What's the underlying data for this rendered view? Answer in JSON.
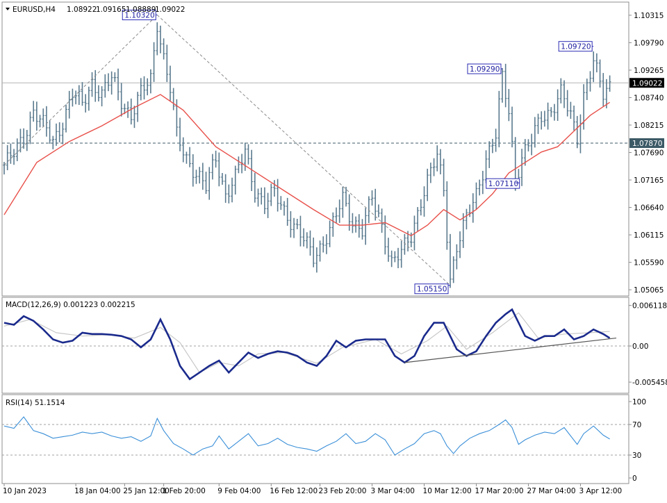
{
  "chart_data": [
    {
      "type": "ohlc",
      "name": "price-panel",
      "header": {
        "symbol": "EURUSD,H4",
        "open": "1.08922",
        "high": "1.09165",
        "low": "1.08889",
        "close": "1.09022"
      },
      "ylim": [
        1.05,
        1.105
      ],
      "yticks": [
        "1.10315",
        "1.09790",
        "1.09265",
        "1.08740",
        "1.08215",
        "1.07690",
        "1.07165",
        "1.06640",
        "1.06115",
        "1.05590",
        "1.05065"
      ],
      "current_price": "1.09022",
      "level_line": "1.07870",
      "ma_color": "#e8504a",
      "bar_color": "#5a7a8e",
      "anchors": [
        {
          "x": 0,
          "y": 1.0745
        },
        {
          "x": 3,
          "y": 1.0765
        },
        {
          "x": 6,
          "y": 1.08
        },
        {
          "x": 9,
          "y": 1.085
        },
        {
          "x": 12,
          "y": 1.082
        },
        {
          "x": 15,
          "y": 1.079
        },
        {
          "x": 18,
          "y": 1.083
        },
        {
          "x": 21,
          "y": 1.088
        },
        {
          "x": 24,
          "y": 1.086
        },
        {
          "x": 27,
          "y": 1.0905
        },
        {
          "x": 30,
          "y": 1.088
        },
        {
          "x": 33,
          "y": 1.091
        },
        {
          "x": 36,
          "y": 1.087
        },
        {
          "x": 39,
          "y": 1.084
        },
        {
          "x": 42,
          "y": 1.088
        },
        {
          "x": 45,
          "y": 1.091
        },
        {
          "x": 47,
          "y": 1.102
        },
        {
          "x": 49,
          "y": 1.095
        },
        {
          "x": 51,
          "y": 1.089
        },
        {
          "x": 53,
          "y": 1.08
        },
        {
          "x": 56,
          "y": 1.076
        },
        {
          "x": 59,
          "y": 1.073
        },
        {
          "x": 62,
          "y": 1.07
        },
        {
          "x": 65,
          "y": 1.076
        },
        {
          "x": 68,
          "y": 1.069
        },
        {
          "x": 71,
          "y": 1.072
        },
        {
          "x": 74,
          "y": 1.077
        },
        {
          "x": 77,
          "y": 1.07
        },
        {
          "x": 80,
          "y": 1.067
        },
        {
          "x": 83,
          "y": 1.069
        },
        {
          "x": 86,
          "y": 1.066
        },
        {
          "x": 89,
          "y": 1.063
        },
        {
          "x": 92,
          "y": 1.06
        },
        {
          "x": 95,
          "y": 1.057
        },
        {
          "x": 98,
          "y": 1.06
        },
        {
          "x": 101,
          "y": 1.063
        },
        {
          "x": 104,
          "y": 1.068
        },
        {
          "x": 107,
          "y": 1.064
        },
        {
          "x": 110,
          "y": 1.062
        },
        {
          "x": 113,
          "y": 1.068
        },
        {
          "x": 116,
          "y": 1.063
        },
        {
          "x": 119,
          "y": 1.056
        },
        {
          "x": 122,
          "y": 1.0575
        },
        {
          "x": 125,
          "y": 1.061
        },
        {
          "x": 128,
          "y": 1.068
        },
        {
          "x": 131,
          "y": 1.073
        },
        {
          "x": 133,
          "y": 1.076
        },
        {
          "x": 135,
          "y": 1.07
        },
        {
          "x": 137,
          "y": 1.053
        },
        {
          "x": 139,
          "y": 1.059
        },
        {
          "x": 142,
          "y": 1.064
        },
        {
          "x": 145,
          "y": 1.069
        },
        {
          "x": 148,
          "y": 1.076
        },
        {
          "x": 151,
          "y": 1.08
        },
        {
          "x": 153,
          "y": 1.091
        },
        {
          "x": 155,
          "y": 1.085
        },
        {
          "x": 157,
          "y": 1.072
        },
        {
          "x": 159,
          "y": 1.076
        },
        {
          "x": 162,
          "y": 1.079
        },
        {
          "x": 165,
          "y": 1.084
        },
        {
          "x": 168,
          "y": 1.085
        },
        {
          "x": 171,
          "y": 1.088
        },
        {
          "x": 174,
          "y": 1.084
        },
        {
          "x": 176,
          "y": 1.08
        },
        {
          "x": 178,
          "y": 1.088
        },
        {
          "x": 181,
          "y": 1.094
        },
        {
          "x": 184,
          "y": 1.088
        },
        {
          "x": 186,
          "y": 1.09
        }
      ],
      "ma": [
        {
          "x": 0,
          "y": 1.065
        },
        {
          "x": 10,
          "y": 1.075
        },
        {
          "x": 20,
          "y": 1.079
        },
        {
          "x": 30,
          "y": 1.082
        },
        {
          "x": 40,
          "y": 1.0855
        },
        {
          "x": 48,
          "y": 1.088
        },
        {
          "x": 55,
          "y": 1.085
        },
        {
          "x": 65,
          "y": 1.078
        },
        {
          "x": 75,
          "y": 1.074
        },
        {
          "x": 85,
          "y": 1.07
        },
        {
          "x": 95,
          "y": 1.066
        },
        {
          "x": 103,
          "y": 1.063
        },
        {
          "x": 110,
          "y": 1.063
        },
        {
          "x": 117,
          "y": 1.0635
        },
        {
          "x": 125,
          "y": 1.061
        },
        {
          "x": 130,
          "y": 1.063
        },
        {
          "x": 135,
          "y": 1.066
        },
        {
          "x": 140,
          "y": 1.064
        },
        {
          "x": 145,
          "y": 1.066
        },
        {
          "x": 150,
          "y": 1.069
        },
        {
          "x": 155,
          "y": 1.073
        },
        {
          "x": 160,
          "y": 1.075
        },
        {
          "x": 165,
          "y": 1.077
        },
        {
          "x": 170,
          "y": 1.078
        },
        {
          "x": 175,
          "y": 1.081
        },
        {
          "x": 180,
          "y": 1.084
        },
        {
          "x": 186,
          "y": 1.0865
        }
      ],
      "annotations": [
        {
          "label": "1.10320",
          "bar": 47,
          "price": 1.1032
        },
        {
          "label": "1.05150",
          "bar": 137,
          "price": 1.0515
        },
        {
          "label": "1.09290",
          "bar": 153,
          "price": 1.0929
        },
        {
          "label": "1.07110",
          "bar": 157,
          "price": 1.0711
        },
        {
          "label": "1.09720",
          "bar": 181,
          "price": 1.0972
        }
      ],
      "trendlines": [
        {
          "style": "dashed",
          "from": {
            "bar": 0,
            "price": 1.0745
          },
          "to": {
            "bar": 47,
            "price": 1.1032
          }
        },
        {
          "style": "dashed",
          "from": {
            "bar": 47,
            "price": 1.1032
          },
          "to": {
            "bar": 137,
            "price": 1.0515
          }
        }
      ]
    },
    {
      "type": "line",
      "name": "macd-panel",
      "title": "MACD(12,26,9) 0.001223 0.002215",
      "ylim": [
        -0.0065,
        0.0065
      ],
      "yticks": [
        "0.006118",
        "0.00",
        "-0.005458"
      ],
      "macd_color": "#1a2a8c",
      "signal_color": "#c8c8c8",
      "macd": [
        {
          "x": 0,
          "y": 0.0035
        },
        {
          "x": 3,
          "y": 0.0032
        },
        {
          "x": 6,
          "y": 0.0045
        },
        {
          "x": 9,
          "y": 0.0038
        },
        {
          "x": 12,
          "y": 0.0025
        },
        {
          "x": 15,
          "y": 0.001
        },
        {
          "x": 18,
          "y": 0.0005
        },
        {
          "x": 21,
          "y": 0.0008
        },
        {
          "x": 24,
          "y": 0.002
        },
        {
          "x": 27,
          "y": 0.0018
        },
        {
          "x": 30,
          "y": 0.0018
        },
        {
          "x": 33,
          "y": 0.0017
        },
        {
          "x": 36,
          "y": 0.0015
        },
        {
          "x": 39,
          "y": 0.001
        },
        {
          "x": 42,
          "y": -0.0002
        },
        {
          "x": 45,
          "y": 0.001
        },
        {
          "x": 48,
          "y": 0.004
        },
        {
          "x": 51,
          "y": 0.001
        },
        {
          "x": 54,
          "y": -0.003
        },
        {
          "x": 57,
          "y": -0.005
        },
        {
          "x": 60,
          "y": -0.004
        },
        {
          "x": 63,
          "y": -0.003
        },
        {
          "x": 66,
          "y": -0.0022
        },
        {
          "x": 69,
          "y": -0.004
        },
        {
          "x": 72,
          "y": -0.0025
        },
        {
          "x": 75,
          "y": -0.001
        },
        {
          "x": 78,
          "y": -0.0018
        },
        {
          "x": 81,
          "y": -0.0012
        },
        {
          "x": 84,
          "y": -0.0008
        },
        {
          "x": 87,
          "y": -0.001
        },
        {
          "x": 90,
          "y": -0.0015
        },
        {
          "x": 93,
          "y": -0.0025
        },
        {
          "x": 96,
          "y": -0.003
        },
        {
          "x": 99,
          "y": -0.0015
        },
        {
          "x": 102,
          "y": 0.0008
        },
        {
          "x": 105,
          "y": -0.0002
        },
        {
          "x": 108,
          "y": 0.0008
        },
        {
          "x": 111,
          "y": 0.001
        },
        {
          "x": 114,
          "y": 0.001
        },
        {
          "x": 117,
          "y": 0.001
        },
        {
          "x": 120,
          "y": -0.0015
        },
        {
          "x": 123,
          "y": -0.0025
        },
        {
          "x": 126,
          "y": -0.0015
        },
        {
          "x": 129,
          "y": 0.0015
        },
        {
          "x": 132,
          "y": 0.0035
        },
        {
          "x": 135,
          "y": 0.0035
        },
        {
          "x": 137,
          "y": 0.0015
        },
        {
          "x": 139,
          "y": -0.0005
        },
        {
          "x": 142,
          "y": -0.0015
        },
        {
          "x": 145,
          "y": -0.0008
        },
        {
          "x": 148,
          "y": 0.0015
        },
        {
          "x": 151,
          "y": 0.0035
        },
        {
          "x": 154,
          "y": 0.0048
        },
        {
          "x": 156,
          "y": 0.0055
        },
        {
          "x": 158,
          "y": 0.0035
        },
        {
          "x": 160,
          "y": 0.0015
        },
        {
          "x": 163,
          "y": 0.0008
        },
        {
          "x": 166,
          "y": 0.0015
        },
        {
          "x": 169,
          "y": 0.0015
        },
        {
          "x": 172,
          "y": 0.0025
        },
        {
          "x": 175,
          "y": 0.001
        },
        {
          "x": 178,
          "y": 0.0015
        },
        {
          "x": 181,
          "y": 0.0025
        },
        {
          "x": 184,
          "y": 0.0018
        },
        {
          "x": 186,
          "y": 0.0012
        }
      ],
      "signal": [
        {
          "x": 0,
          "y": 0.003
        },
        {
          "x": 8,
          "y": 0.004
        },
        {
          "x": 16,
          "y": 0.002
        },
        {
          "x": 24,
          "y": 0.0015
        },
        {
          "x": 32,
          "y": 0.0017
        },
        {
          "x": 40,
          "y": 0.0012
        },
        {
          "x": 48,
          "y": 0.0028
        },
        {
          "x": 54,
          "y": 0.0005
        },
        {
          "x": 60,
          "y": -0.004
        },
        {
          "x": 66,
          "y": -0.0025
        },
        {
          "x": 72,
          "y": -0.003
        },
        {
          "x": 78,
          "y": -0.0012
        },
        {
          "x": 86,
          "y": -0.001
        },
        {
          "x": 96,
          "y": -0.0026
        },
        {
          "x": 104,
          "y": -0.0002
        },
        {
          "x": 114,
          "y": 0.001
        },
        {
          "x": 122,
          "y": -0.0012
        },
        {
          "x": 130,
          "y": 0.0008
        },
        {
          "x": 136,
          "y": 0.003
        },
        {
          "x": 142,
          "y": -0.0005
        },
        {
          "x": 150,
          "y": 0.002
        },
        {
          "x": 158,
          "y": 0.005
        },
        {
          "x": 164,
          "y": 0.0012
        },
        {
          "x": 172,
          "y": 0.0018
        },
        {
          "x": 180,
          "y": 0.002
        },
        {
          "x": 186,
          "y": 0.0022
        }
      ],
      "trendline": {
        "from": {
          "bar": 123,
          "value": -0.0025
        },
        "to": {
          "bar": 188,
          "value": 0.0012
        }
      }
    },
    {
      "type": "line",
      "name": "rsi-panel",
      "title": "RSI(14) 51.1514",
      "ylim": [
        0,
        100
      ],
      "yticks": [
        "100",
        "70",
        "30",
        "0"
      ],
      "levels": [
        70,
        30
      ],
      "line_color": "#3a8fd8",
      "rsi": [
        {
          "x": 0,
          "y": 68
        },
        {
          "x": 3,
          "y": 65
        },
        {
          "x": 6,
          "y": 80
        },
        {
          "x": 9,
          "y": 62
        },
        {
          "x": 12,
          "y": 58
        },
        {
          "x": 15,
          "y": 52
        },
        {
          "x": 18,
          "y": 54
        },
        {
          "x": 21,
          "y": 56
        },
        {
          "x": 24,
          "y": 60
        },
        {
          "x": 27,
          "y": 58
        },
        {
          "x": 30,
          "y": 60
        },
        {
          "x": 33,
          "y": 55
        },
        {
          "x": 36,
          "y": 52
        },
        {
          "x": 39,
          "y": 54
        },
        {
          "x": 42,
          "y": 48
        },
        {
          "x": 45,
          "y": 55
        },
        {
          "x": 47,
          "y": 78
        },
        {
          "x": 49,
          "y": 62
        },
        {
          "x": 52,
          "y": 45
        },
        {
          "x": 55,
          "y": 38
        },
        {
          "x": 58,
          "y": 30
        },
        {
          "x": 61,
          "y": 38
        },
        {
          "x": 64,
          "y": 42
        },
        {
          "x": 66,
          "y": 55
        },
        {
          "x": 69,
          "y": 38
        },
        {
          "x": 72,
          "y": 48
        },
        {
          "x": 75,
          "y": 58
        },
        {
          "x": 78,
          "y": 42
        },
        {
          "x": 81,
          "y": 45
        },
        {
          "x": 84,
          "y": 52
        },
        {
          "x": 87,
          "y": 44
        },
        {
          "x": 90,
          "y": 40
        },
        {
          "x": 93,
          "y": 38
        },
        {
          "x": 96,
          "y": 35
        },
        {
          "x": 99,
          "y": 42
        },
        {
          "x": 102,
          "y": 48
        },
        {
          "x": 105,
          "y": 58
        },
        {
          "x": 108,
          "y": 45
        },
        {
          "x": 111,
          "y": 48
        },
        {
          "x": 114,
          "y": 58
        },
        {
          "x": 117,
          "y": 50
        },
        {
          "x": 120,
          "y": 30
        },
        {
          "x": 123,
          "y": 38
        },
        {
          "x": 126,
          "y": 45
        },
        {
          "x": 129,
          "y": 58
        },
        {
          "x": 132,
          "y": 62
        },
        {
          "x": 134,
          "y": 58
        },
        {
          "x": 136,
          "y": 42
        },
        {
          "x": 138,
          "y": 32
        },
        {
          "x": 140,
          "y": 42
        },
        {
          "x": 143,
          "y": 52
        },
        {
          "x": 146,
          "y": 58
        },
        {
          "x": 149,
          "y": 62
        },
        {
          "x": 152,
          "y": 70
        },
        {
          "x": 154,
          "y": 76
        },
        {
          "x": 156,
          "y": 66
        },
        {
          "x": 158,
          "y": 44
        },
        {
          "x": 160,
          "y": 50
        },
        {
          "x": 163,
          "y": 56
        },
        {
          "x": 166,
          "y": 60
        },
        {
          "x": 169,
          "y": 58
        },
        {
          "x": 172,
          "y": 66
        },
        {
          "x": 174,
          "y": 55
        },
        {
          "x": 176,
          "y": 44
        },
        {
          "x": 178,
          "y": 58
        },
        {
          "x": 181,
          "y": 68
        },
        {
          "x": 184,
          "y": 56
        },
        {
          "x": 186,
          "y": 51
        }
      ]
    }
  ],
  "x_axis": {
    "labels": [
      {
        "label": "10 Jan 2023",
        "bar": 0
      },
      {
        "label": "18 Jan 04:00",
        "bar": 22
      },
      {
        "label": "25 Jan 12:00",
        "bar": 37
      },
      {
        "label": "1 Feb 20:00",
        "bar": 49
      },
      {
        "label": "9 Feb 04:00",
        "bar": 66
      },
      {
        "label": "16 Feb 12:00",
        "bar": 82
      },
      {
        "label": "23 Feb 20:00",
        "bar": 97
      },
      {
        "label": "3 Mar 04:00",
        "bar": 113
      },
      {
        "label": "10 Mar 12:00",
        "bar": 129
      },
      {
        "label": "17 Mar 20:00",
        "bar": 145
      },
      {
        "label": "27 Mar 04:00",
        "bar": 161
      },
      {
        "label": "3 Apr 12:00",
        "bar": 177
      }
    ]
  }
}
